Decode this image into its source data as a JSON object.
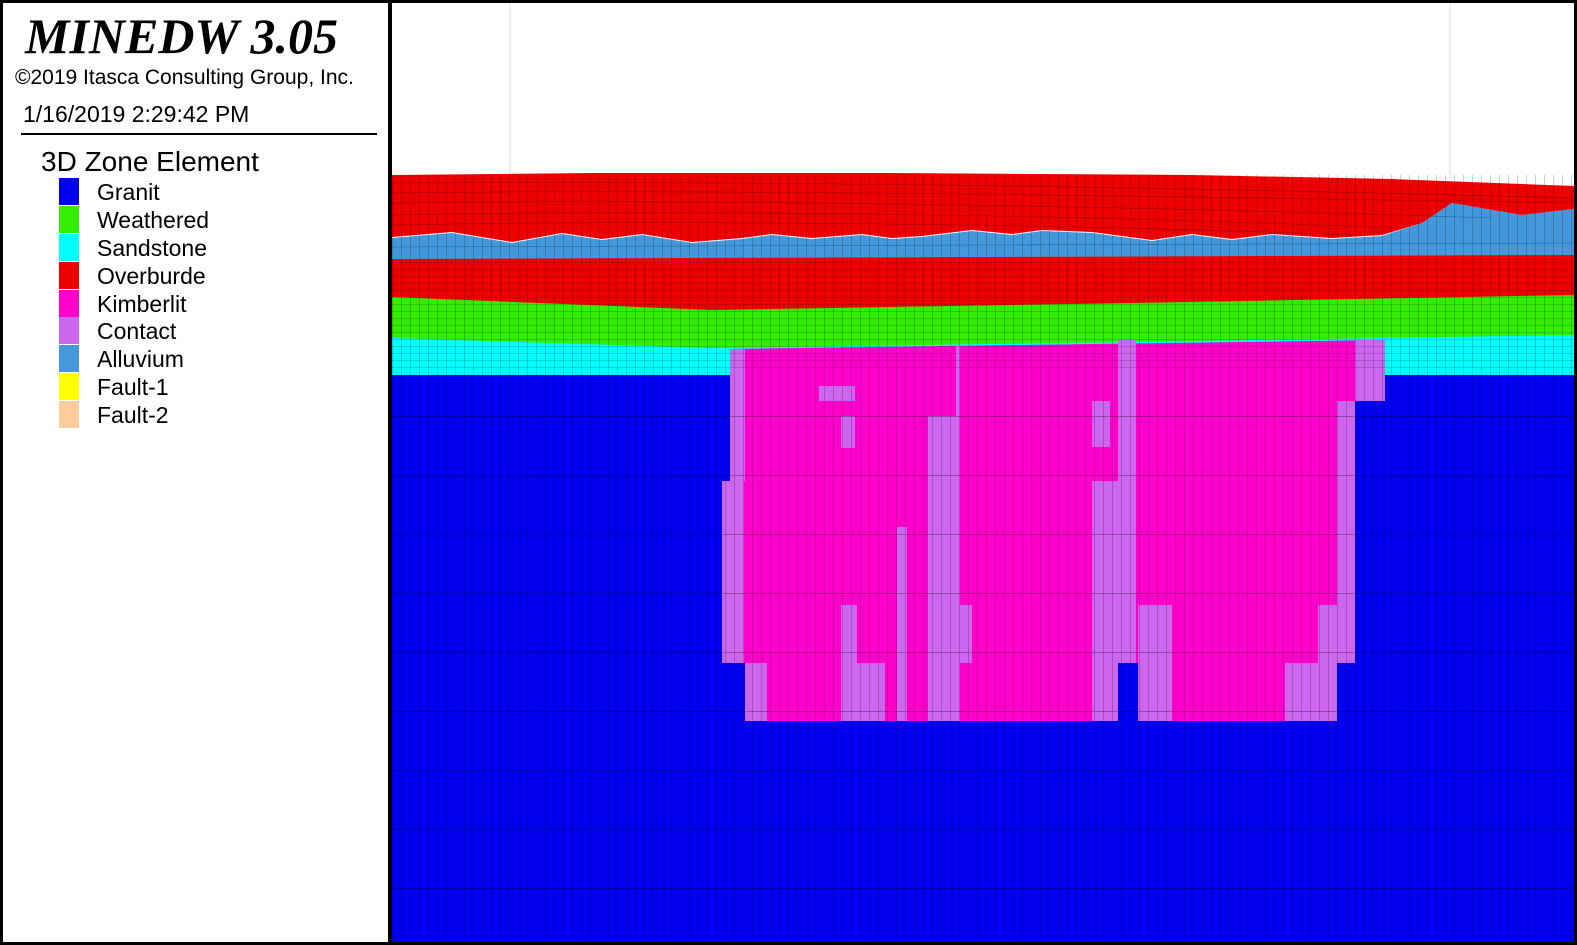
{
  "header": {
    "app_title": "MINEDW 3.05",
    "copyright": "©2019 Itasca Consulting Group, Inc.",
    "timestamp": "1/16/2019 2:29:42 PM"
  },
  "legend": {
    "title": "3D Zone Element",
    "items": [
      {
        "label": "Granit",
        "color": "#0000f0"
      },
      {
        "label": "Weathered",
        "color": "#33ee00"
      },
      {
        "label": "Sandstone",
        "color": "#00ffff"
      },
      {
        "label": "Overburde",
        "color": "#ee0000"
      },
      {
        "label": "Kimberlit",
        "color": "#ff00cc"
      },
      {
        "label": "Contact",
        "color": "#cc66ee"
      },
      {
        "label": "Alluvium",
        "color": "#4499dd"
      },
      {
        "label": "Fault-1",
        "color": "#ffff00"
      },
      {
        "label": "Fault-2",
        "color": "#ffcc99"
      }
    ]
  },
  "colors": {
    "mesh_line": "#000000",
    "background": "#ffffff"
  }
}
